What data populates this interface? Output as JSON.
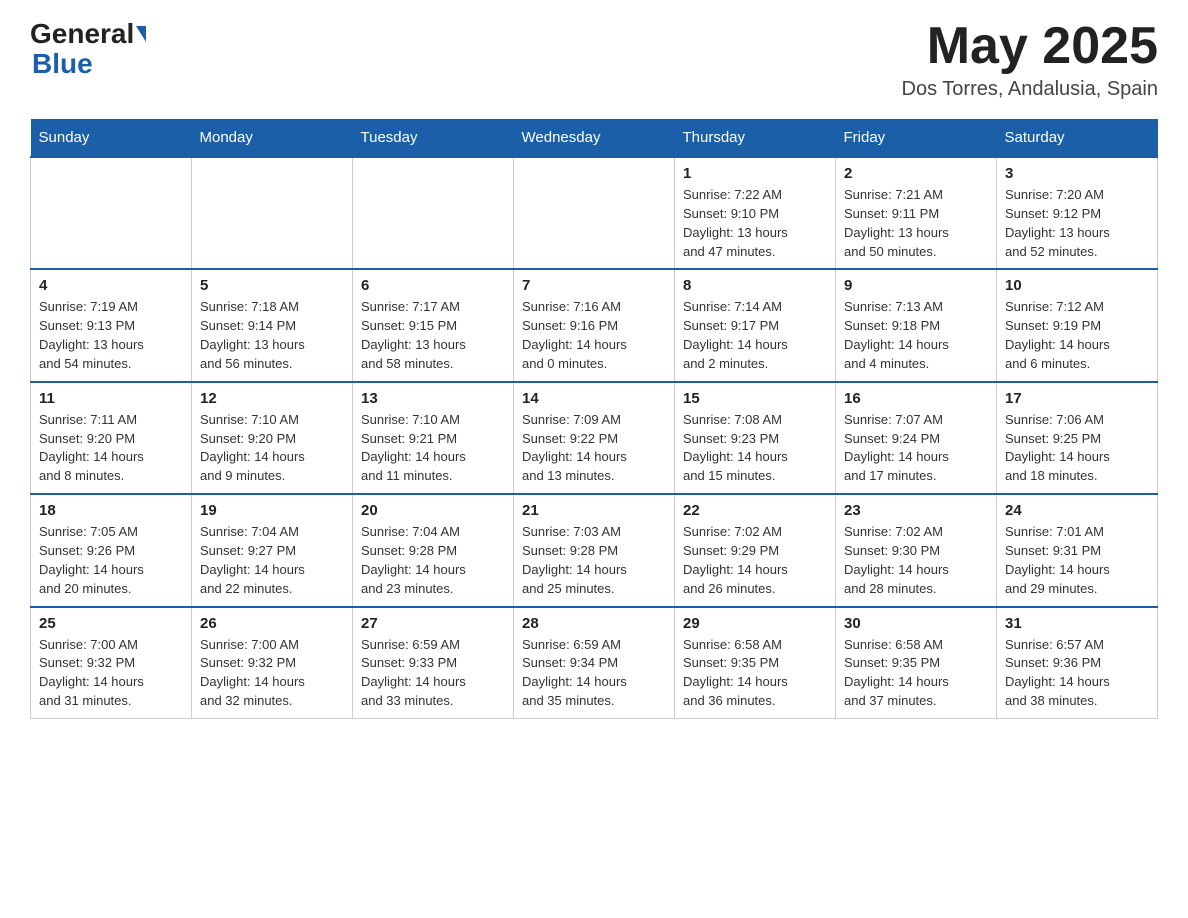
{
  "header": {
    "logo_general": "General",
    "logo_blue": "Blue",
    "month_title": "May 2025",
    "location": "Dos Torres, Andalusia, Spain"
  },
  "days_of_week": [
    "Sunday",
    "Monday",
    "Tuesday",
    "Wednesday",
    "Thursday",
    "Friday",
    "Saturday"
  ],
  "weeks": [
    [
      {
        "day": "",
        "info": ""
      },
      {
        "day": "",
        "info": ""
      },
      {
        "day": "",
        "info": ""
      },
      {
        "day": "",
        "info": ""
      },
      {
        "day": "1",
        "info": "Sunrise: 7:22 AM\nSunset: 9:10 PM\nDaylight: 13 hours\nand 47 minutes."
      },
      {
        "day": "2",
        "info": "Sunrise: 7:21 AM\nSunset: 9:11 PM\nDaylight: 13 hours\nand 50 minutes."
      },
      {
        "day": "3",
        "info": "Sunrise: 7:20 AM\nSunset: 9:12 PM\nDaylight: 13 hours\nand 52 minutes."
      }
    ],
    [
      {
        "day": "4",
        "info": "Sunrise: 7:19 AM\nSunset: 9:13 PM\nDaylight: 13 hours\nand 54 minutes."
      },
      {
        "day": "5",
        "info": "Sunrise: 7:18 AM\nSunset: 9:14 PM\nDaylight: 13 hours\nand 56 minutes."
      },
      {
        "day": "6",
        "info": "Sunrise: 7:17 AM\nSunset: 9:15 PM\nDaylight: 13 hours\nand 58 minutes."
      },
      {
        "day": "7",
        "info": "Sunrise: 7:16 AM\nSunset: 9:16 PM\nDaylight: 14 hours\nand 0 minutes."
      },
      {
        "day": "8",
        "info": "Sunrise: 7:14 AM\nSunset: 9:17 PM\nDaylight: 14 hours\nand 2 minutes."
      },
      {
        "day": "9",
        "info": "Sunrise: 7:13 AM\nSunset: 9:18 PM\nDaylight: 14 hours\nand 4 minutes."
      },
      {
        "day": "10",
        "info": "Sunrise: 7:12 AM\nSunset: 9:19 PM\nDaylight: 14 hours\nand 6 minutes."
      }
    ],
    [
      {
        "day": "11",
        "info": "Sunrise: 7:11 AM\nSunset: 9:20 PM\nDaylight: 14 hours\nand 8 minutes."
      },
      {
        "day": "12",
        "info": "Sunrise: 7:10 AM\nSunset: 9:20 PM\nDaylight: 14 hours\nand 9 minutes."
      },
      {
        "day": "13",
        "info": "Sunrise: 7:10 AM\nSunset: 9:21 PM\nDaylight: 14 hours\nand 11 minutes."
      },
      {
        "day": "14",
        "info": "Sunrise: 7:09 AM\nSunset: 9:22 PM\nDaylight: 14 hours\nand 13 minutes."
      },
      {
        "day": "15",
        "info": "Sunrise: 7:08 AM\nSunset: 9:23 PM\nDaylight: 14 hours\nand 15 minutes."
      },
      {
        "day": "16",
        "info": "Sunrise: 7:07 AM\nSunset: 9:24 PM\nDaylight: 14 hours\nand 17 minutes."
      },
      {
        "day": "17",
        "info": "Sunrise: 7:06 AM\nSunset: 9:25 PM\nDaylight: 14 hours\nand 18 minutes."
      }
    ],
    [
      {
        "day": "18",
        "info": "Sunrise: 7:05 AM\nSunset: 9:26 PM\nDaylight: 14 hours\nand 20 minutes."
      },
      {
        "day": "19",
        "info": "Sunrise: 7:04 AM\nSunset: 9:27 PM\nDaylight: 14 hours\nand 22 minutes."
      },
      {
        "day": "20",
        "info": "Sunrise: 7:04 AM\nSunset: 9:28 PM\nDaylight: 14 hours\nand 23 minutes."
      },
      {
        "day": "21",
        "info": "Sunrise: 7:03 AM\nSunset: 9:28 PM\nDaylight: 14 hours\nand 25 minutes."
      },
      {
        "day": "22",
        "info": "Sunrise: 7:02 AM\nSunset: 9:29 PM\nDaylight: 14 hours\nand 26 minutes."
      },
      {
        "day": "23",
        "info": "Sunrise: 7:02 AM\nSunset: 9:30 PM\nDaylight: 14 hours\nand 28 minutes."
      },
      {
        "day": "24",
        "info": "Sunrise: 7:01 AM\nSunset: 9:31 PM\nDaylight: 14 hours\nand 29 minutes."
      }
    ],
    [
      {
        "day": "25",
        "info": "Sunrise: 7:00 AM\nSunset: 9:32 PM\nDaylight: 14 hours\nand 31 minutes."
      },
      {
        "day": "26",
        "info": "Sunrise: 7:00 AM\nSunset: 9:32 PM\nDaylight: 14 hours\nand 32 minutes."
      },
      {
        "day": "27",
        "info": "Sunrise: 6:59 AM\nSunset: 9:33 PM\nDaylight: 14 hours\nand 33 minutes."
      },
      {
        "day": "28",
        "info": "Sunrise: 6:59 AM\nSunset: 9:34 PM\nDaylight: 14 hours\nand 35 minutes."
      },
      {
        "day": "29",
        "info": "Sunrise: 6:58 AM\nSunset: 9:35 PM\nDaylight: 14 hours\nand 36 minutes."
      },
      {
        "day": "30",
        "info": "Sunrise: 6:58 AM\nSunset: 9:35 PM\nDaylight: 14 hours\nand 37 minutes."
      },
      {
        "day": "31",
        "info": "Sunrise: 6:57 AM\nSunset: 9:36 PM\nDaylight: 14 hours\nand 38 minutes."
      }
    ]
  ]
}
